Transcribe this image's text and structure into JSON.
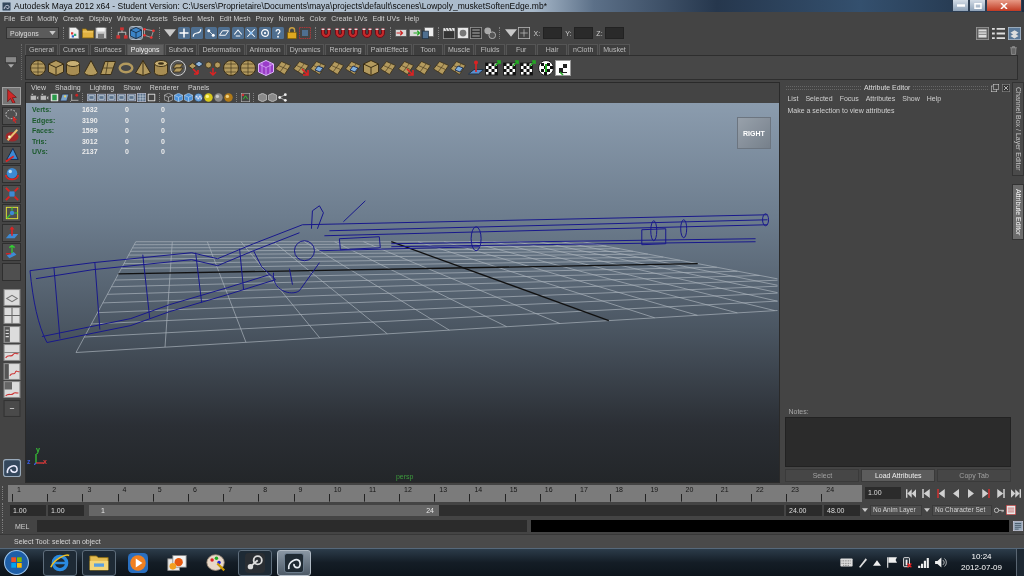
{
  "window": {
    "title": "Autodesk Maya 2012 x64 - Student Version: C:\\Users\\Proprietaire\\Documents\\maya\\projects\\default\\scenes\\Lowpoly_musketSoftenEdge.mb*"
  },
  "menu_bar": [
    "File",
    "Edit",
    "Modify",
    "Create",
    "Display",
    "Window",
    "Assets",
    "Select",
    "Mesh",
    "Edit Mesh",
    "Proxy",
    "Normals",
    "Color",
    "Create UVs",
    "Edit UVs",
    "Help"
  ],
  "status_line": {
    "menu_set": "Polygons",
    "selection_modes": [
      {
        "kind": "hierarchy",
        "selected": false
      },
      {
        "kind": "object",
        "selected": true
      },
      {
        "kind": "component",
        "selected": false
      }
    ],
    "fields": [
      {
        "label": "X:"
      },
      {
        "label": "Y:"
      },
      {
        "label": "Z:"
      }
    ]
  },
  "shelf": {
    "tabs": [
      {
        "label": "General",
        "selected": false
      },
      {
        "label": "Curves",
        "selected": false
      },
      {
        "label": "Surfaces",
        "selected": false
      },
      {
        "label": "Polygons",
        "selected": true
      },
      {
        "label": "Subdivs",
        "selected": false
      },
      {
        "label": "Deformation",
        "selected": false
      },
      {
        "label": "Animation",
        "selected": false
      },
      {
        "label": "Dynamics",
        "selected": false
      },
      {
        "label": "Rendering",
        "selected": false
      },
      {
        "label": "PaintEffects",
        "selected": false
      },
      {
        "label": "Toon",
        "selected": false
      },
      {
        "label": "Muscle",
        "selected": false
      },
      {
        "label": "Fluids",
        "selected": false
      },
      {
        "label": "Fur",
        "selected": false
      },
      {
        "label": "Hair",
        "selected": false
      },
      {
        "label": "nCloth",
        "selected": false
      },
      {
        "label": "Musket",
        "selected": false
      }
    ]
  },
  "toolbox": [
    {
      "kind": "select",
      "selected": true
    },
    {
      "kind": "lasso",
      "selected": false
    },
    {
      "kind": "paint",
      "selected": false
    },
    {
      "kind": "move",
      "selected": false
    },
    {
      "kind": "rotate",
      "selected": false
    },
    {
      "kind": "scale",
      "selected": false
    },
    {
      "kind": "universal",
      "selected": false
    },
    {
      "kind": "soft",
      "selected": false
    },
    {
      "kind": "show_manip",
      "selected": false
    },
    {
      "kind": "empty",
      "selected": false
    }
  ],
  "viewport": {
    "menus": [
      "View",
      "Shading",
      "Lighting",
      "Show",
      "Renderer",
      "Panels"
    ],
    "hud": [
      {
        "label": "Verts:",
        "values": [
          "1632",
          "0",
          "0"
        ]
      },
      {
        "label": "Edges:",
        "values": [
          "3190",
          "0",
          "0"
        ]
      },
      {
        "label": "Faces:",
        "values": [
          "1599",
          "0",
          "0"
        ]
      },
      {
        "label": "Tris:",
        "values": [
          "3012",
          "0",
          "0"
        ]
      },
      {
        "label": "UVs:",
        "values": [
          "2137",
          "0",
          "0"
        ]
      }
    ],
    "view_cube": "RIGHT",
    "axis_labels": [
      "y",
      "z",
      "x"
    ],
    "camera": "persp"
  },
  "attribute_editor": {
    "title": "Attribute Editor",
    "menus": [
      "List",
      "Selected",
      "Focus",
      "Attributes",
      "Show",
      "Help"
    ],
    "message": "Make a selection to view attributes",
    "notes_label": "Notes:",
    "buttons": [
      {
        "label": "Select",
        "disabled": true
      },
      {
        "label": "Load Attributes",
        "disabled": false
      },
      {
        "label": "Copy Tab",
        "disabled": true
      }
    ]
  },
  "side_tabs": [
    {
      "label": "Channel Box / Layer Editor",
      "selected": false
    },
    {
      "label": "Attribute Editor",
      "selected": true
    }
  ],
  "time_slider": {
    "ticks": [
      "1",
      "2",
      "3",
      "4",
      "5",
      "6",
      "7",
      "8",
      "9",
      "10",
      "11",
      "12",
      "13",
      "14",
      "15",
      "16",
      "17",
      "18",
      "19",
      "20",
      "21",
      "22",
      "23",
      "24"
    ],
    "current_frame": "1.00"
  },
  "range_slider": {
    "start_time": "1.00",
    "playback_start": "1.00",
    "handle_start": "1",
    "handle_end": "24",
    "playback_end": "24.00",
    "end_time": "48.00",
    "anim_layer": "No Anim Layer",
    "character_set": "No Character Set"
  },
  "command_line": {
    "label": "MEL"
  },
  "help_line": "Select Tool: select an object",
  "taskbar": {
    "apps": [
      {
        "kind": "browser",
        "open": true,
        "active": false
      },
      {
        "kind": "folder",
        "open": true,
        "active": false
      },
      {
        "kind": "media",
        "open": false,
        "active": false
      },
      {
        "kind": "photos",
        "open": false,
        "active": false
      },
      {
        "kind": "paint",
        "open": false,
        "active": false
      },
      {
        "kind": "steam",
        "open": true,
        "active": false
      },
      {
        "kind": "maya",
        "open": true,
        "active": true
      }
    ],
    "time": "10:24",
    "date": "2012-07-09"
  }
}
